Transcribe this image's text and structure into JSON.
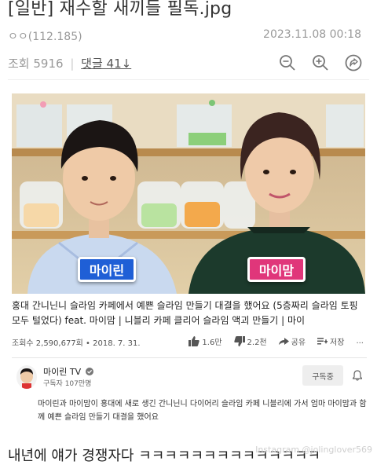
{
  "post": {
    "title": "[일반] 재수할 새끼들 필독.jpg",
    "author": "ㅇㅇ(112.185)",
    "date": "2023.11.08 00:18",
    "views_label": "조회 5916",
    "comments_label": "댓글 41↓"
  },
  "toolbar": {
    "icons": [
      "zoom-out-icon",
      "zoom-in-icon",
      "share-icon"
    ]
  },
  "video": {
    "tag_left": "마이린",
    "tag_right": "마이맘",
    "caption": "홍대 간니닌니 슬라임 카페에서 예쁜 슬라임 만들기 대결을 했어요 (5층짜리 슬라임 토핑 모두 털었다) feat. 마이맘 | 니블리 카페 클리어 슬라임 액괴 만들기 | 마이",
    "views_date": "조회수 2,590,677회 • 2018. 7. 31.",
    "likes": "1.6만",
    "dislikes": "2.2천",
    "share": "공유",
    "save": "저장",
    "more": "..."
  },
  "channel": {
    "name": "마이린 TV",
    "subscribers": "구독자 107만명",
    "subscribe_button": "구독중"
  },
  "description": "마이린과 마이맘이 홍대에 새로 생긴 간니닌니 다이어리 슬라임 카페 니블리에 가서 엄마 마이맘과 함께 예쁜 슬라임 만들기 대결을 했어요",
  "comment": "내년에 얘가 경쟁자다 ㅋㅋㅋㅋㅋㅋㅋㅋㅋㅋㅋㅋㅋㅋ",
  "watermark": "Instagram @jolinglover569",
  "colors": {
    "tag_left": "#1f5fd6",
    "tag_right": "#e0367a",
    "meta_text": "#999999"
  }
}
